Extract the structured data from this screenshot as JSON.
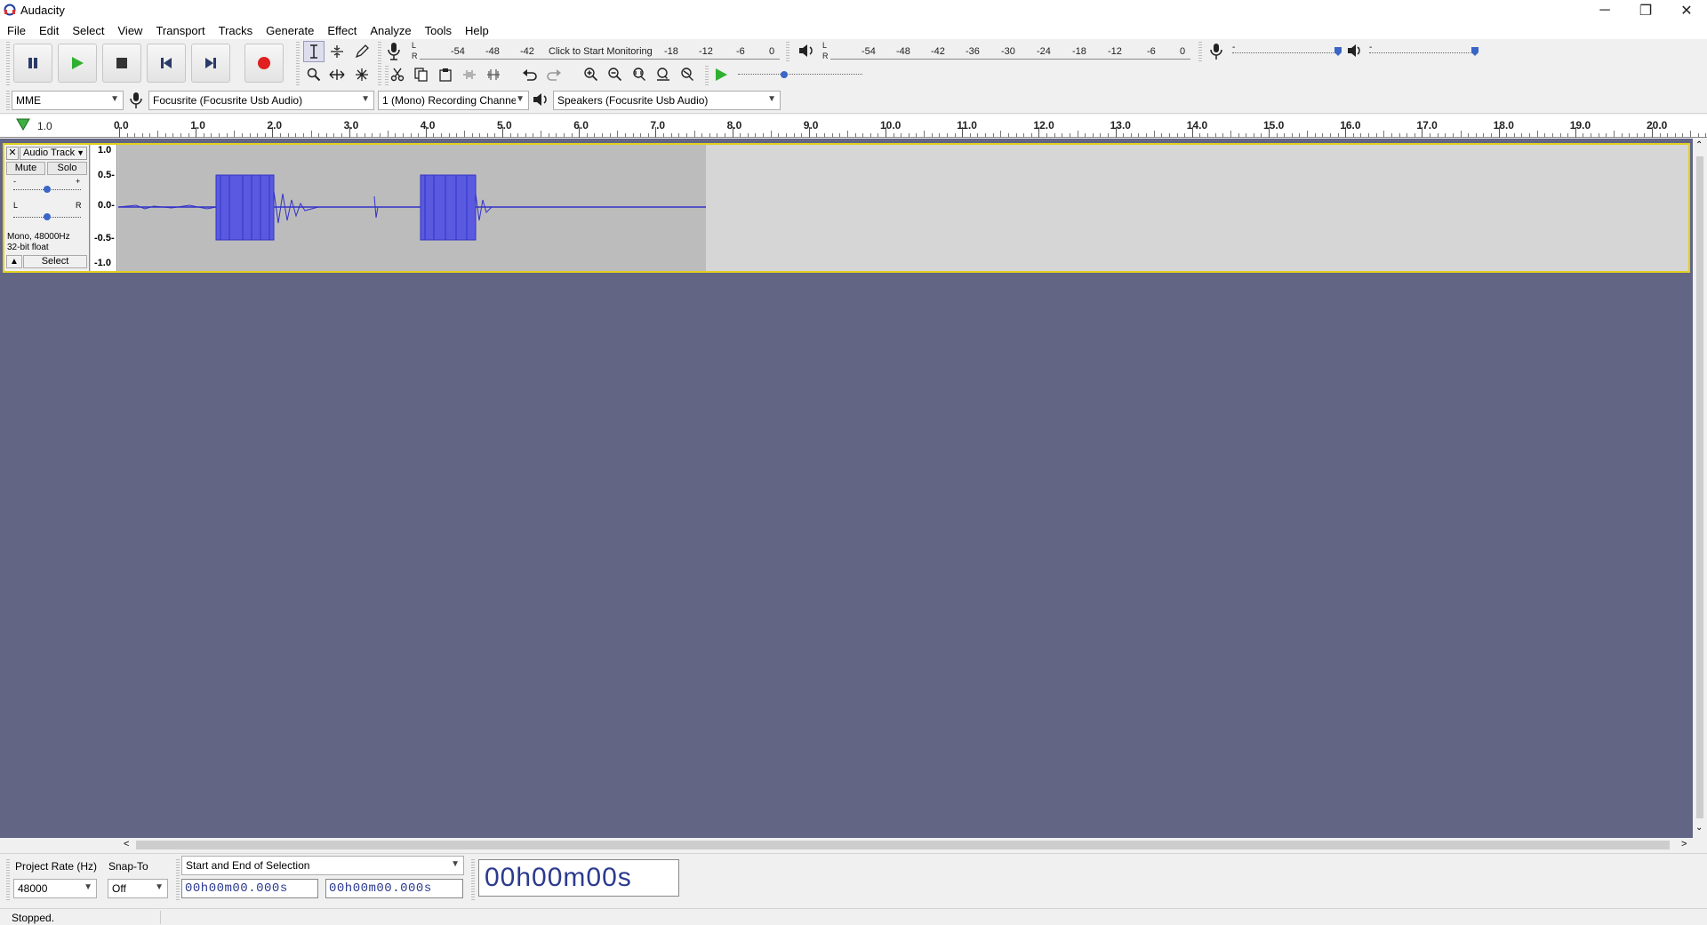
{
  "window": {
    "title": "Audacity",
    "minimize": "─",
    "maximize": "❐",
    "close": "✕"
  },
  "menu": [
    "File",
    "Edit",
    "Select",
    "View",
    "Transport",
    "Tracks",
    "Generate",
    "Effect",
    "Analyze",
    "Tools",
    "Help"
  ],
  "recording_meter": {
    "L": "L",
    "R": "R",
    "scale": [
      "-54",
      "-48",
      "-42",
      "Click to Start Monitoring",
      "-18",
      "-12",
      "-6",
      "0"
    ]
  },
  "playback_meter": {
    "L": "L",
    "R": "R",
    "scale": [
      "-54",
      "-48",
      "-42",
      "-36",
      "-30",
      "-24",
      "-18",
      "-12",
      "-6",
      "0"
    ]
  },
  "device": {
    "host": "MME",
    "recording_device": "Focusrite (Focusrite Usb Audio)",
    "channels": "1 (Mono) Recording Channels",
    "playback_device": "Speakers (Focusrite Usb Audio)"
  },
  "ruler": {
    "left_value": "1.0",
    "ticks": [
      "0.0",
      "1.0",
      "2.0",
      "3.0",
      "4.0",
      "5.0",
      "6.0",
      "7.0",
      "8.0",
      "9.0",
      "10.0",
      "11.0",
      "12.0",
      "13.0",
      "14.0",
      "15.0",
      "16.0",
      "17.0",
      "18.0",
      "19.0",
      "20.0"
    ]
  },
  "track": {
    "name": "Audio Track",
    "mute": "Mute",
    "solo": "Solo",
    "gain_minus": "-",
    "gain_plus": "+",
    "pan_L": "L",
    "pan_R": "R",
    "info_line1": "Mono, 48000Hz",
    "info_line2": "32-bit float",
    "select": "Select",
    "scale": [
      "1.0",
      "0.5-",
      "0.0-",
      "-0.5-",
      "-1.0"
    ]
  },
  "selection": {
    "project_rate_label": "Project Rate (Hz)",
    "project_rate": "48000",
    "snap_to_label": "Snap-To",
    "snap_to": "Off",
    "mode": "Start and End of Selection",
    "start_time": "00h00m00.000s",
    "end_time": "00h00m00.000s",
    "audio_position": "00h00m00s"
  },
  "status": "Stopped.",
  "colors": {
    "waveform": "#3232c8",
    "track_bg": "#626584",
    "selection_border": "#e0d020",
    "time_text": "#2b3a8f",
    "record": "#e02020",
    "play": "#30b030"
  }
}
